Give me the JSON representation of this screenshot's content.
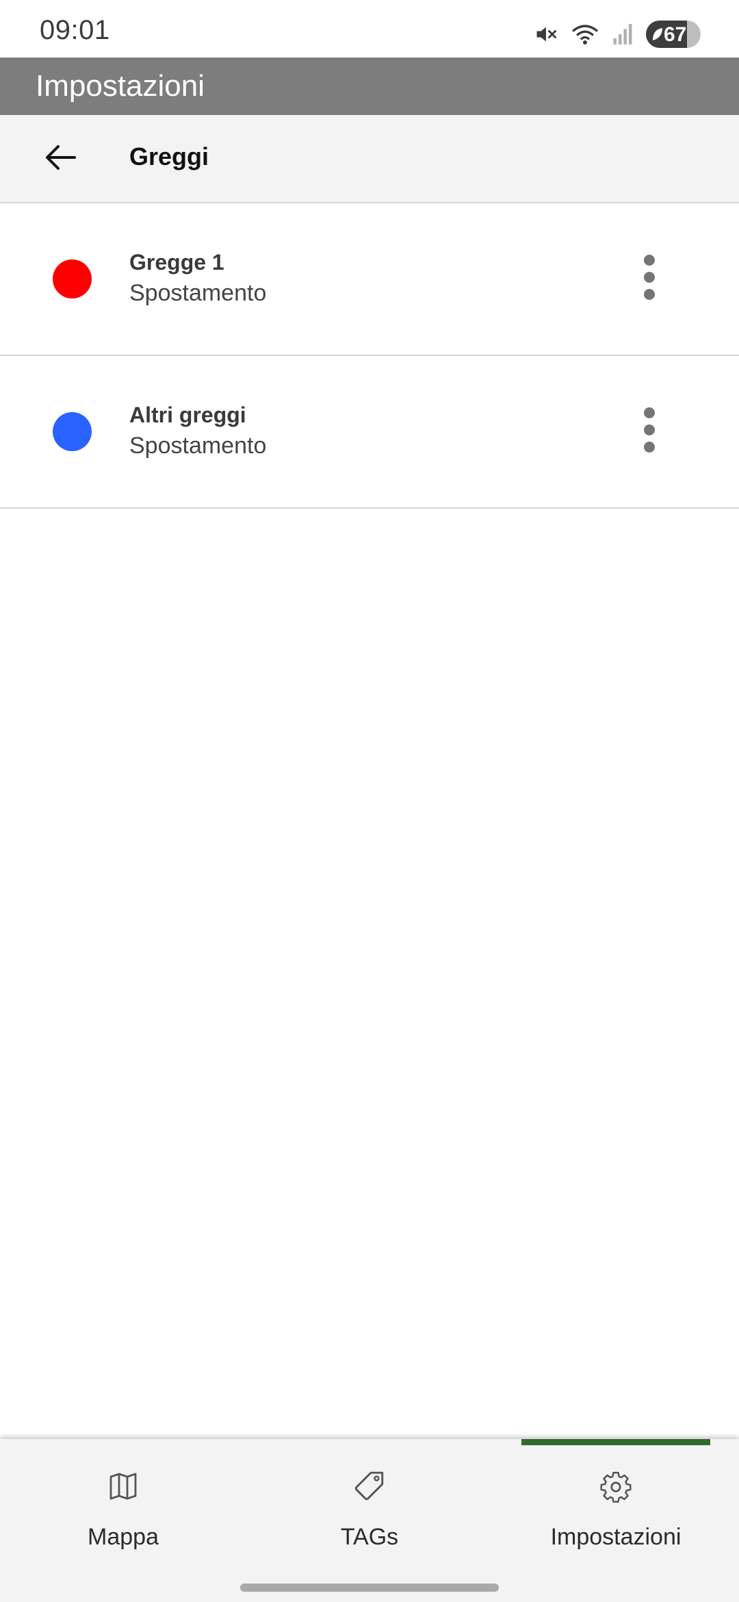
{
  "status_bar": {
    "time": "09:01",
    "battery_percent": "67",
    "icons": [
      "mute-icon",
      "wifi-icon",
      "signal-icon",
      "battery-icon"
    ]
  },
  "app_bar": {
    "title": "Impostazioni",
    "background": "#7d7d7d"
  },
  "sub_header": {
    "title": "Greggi",
    "back_icon": "arrow-left-icon"
  },
  "flocks": [
    {
      "name": "Gregge 1",
      "subtitle": "Spostamento",
      "color": "#ff0000"
    },
    {
      "name": "Altri greggi",
      "subtitle": "Spostamento",
      "color": "#2962ff"
    }
  ],
  "bottom_nav": {
    "active_index": 2,
    "indicator_color": "#2e6b2e",
    "items": [
      {
        "label": "Mappa",
        "icon": "map-icon"
      },
      {
        "label": "TAGs",
        "icon": "tag-icon"
      },
      {
        "label": "Impostazioni",
        "icon": "gear-icon"
      }
    ]
  }
}
